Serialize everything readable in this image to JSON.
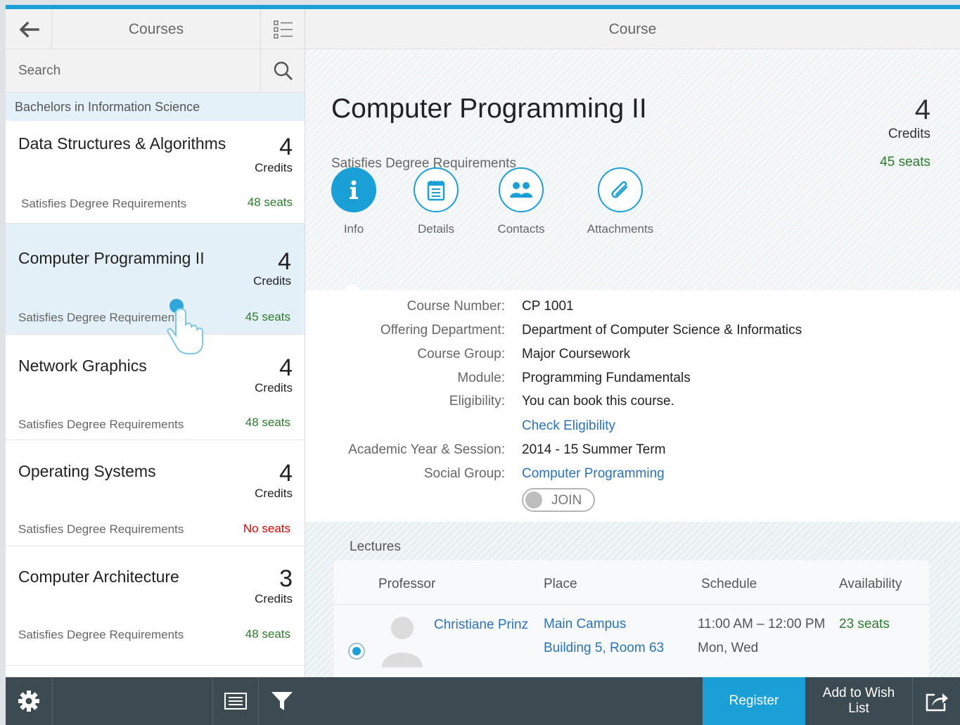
{
  "master": {
    "title": "Courses",
    "search_placeholder": "Search",
    "group_header": "Bachelors in Information Science",
    "courses": [
      {
        "title": "Data Structures & Algorithms",
        "credits": "4",
        "credits_unit": "Credits",
        "requirement": "Satisfies Degree Requirements",
        "seats": "48 seats",
        "selected": false
      },
      {
        "title": "Computer Programming II",
        "credits": "4",
        "credits_unit": "Credits",
        "requirement": "Satisfies Degree Requirements",
        "seats": "45 seats",
        "selected": true
      },
      {
        "title": "Network Graphics",
        "credits": "4",
        "credits_unit": "Credits",
        "requirement": "Satisfies Degree Requirements",
        "seats": "48 seats",
        "selected": false
      },
      {
        "title": "Operating Systems",
        "credits": "4",
        "credits_unit": "Credits",
        "requirement": "Satisfies Degree Requirements",
        "seats": "No seats",
        "selected": false
      },
      {
        "title": "Computer Architecture",
        "credits": "3",
        "credits_unit": "Credits",
        "requirement": "Satisfies Degree Requirements",
        "seats": "48 seats",
        "selected": false
      }
    ]
  },
  "detail": {
    "title": "Course",
    "course_title": "Computer Programming II",
    "credits": "4",
    "credits_unit": "Credits",
    "requirement": "Satisfies Degree Requirements",
    "seats": "45 seats",
    "tabs": [
      {
        "label": "Info",
        "icon": "info-icon",
        "active": true
      },
      {
        "label": "Details",
        "icon": "notepad-icon",
        "active": false
      },
      {
        "label": "Contacts",
        "icon": "group-icon",
        "active": false
      },
      {
        "label": "Attachments",
        "icon": "paperclip-icon",
        "active": false
      }
    ],
    "form": {
      "course_number_label": "Course Number:",
      "course_number": "CP 1001",
      "department_label": "Offering Department:",
      "department": "Department of Computer Science & Informatics",
      "group_label": "Course Group:",
      "group": "Major Coursework",
      "module_label": "Module:",
      "module": "Programming Fundamentals",
      "eligibility_label": "Eligibility:",
      "eligibility": "You can book this course.",
      "check_eligibility": "Check Eligibility",
      "session_label": "Academic Year & Session:",
      "session": "2014 - 15 Summer Term",
      "social_label": "Social Group:",
      "social_group": "Computer Programming",
      "join_label": "JOIN"
    },
    "lectures": {
      "title": "Lectures",
      "columns": [
        "Professor",
        "Place",
        "Schedule",
        "Availability"
      ],
      "rows": [
        {
          "professor": "Christiane Prinz",
          "place_line1": "Main Campus",
          "place_line2": "Building 5, Room 63",
          "time": "11:00 AM – 12:00 PM",
          "days": "Mon, Wed",
          "availability": "23 seats"
        }
      ]
    }
  },
  "footer": {
    "register": "Register",
    "wish_list": "Add to Wish List"
  },
  "colors": {
    "accent": "#1b9fd7",
    "positive": "#2b7c2b",
    "negative": "#e00000",
    "link": "#2a73b9",
    "footer": "#3c4a52"
  }
}
